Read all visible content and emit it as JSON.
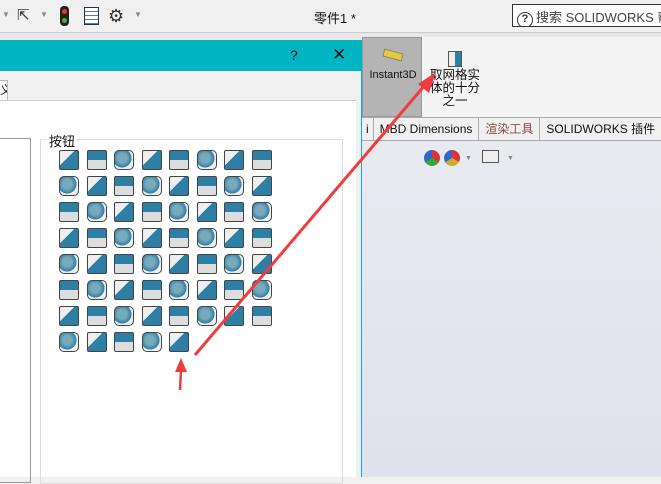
{
  "toolbar": {
    "title": "零件1 *",
    "search_placeholder": "搜索 SOLIDWORKS 帮助",
    "icons": [
      "chevron-down-icon",
      "cursor-icon",
      "traffic-light-icon",
      "properties-list-icon",
      "gear-icon"
    ]
  },
  "ribbon": {
    "instant3d_label": "Instant3D",
    "mesh_button_label": "取网格实体的十分之一"
  },
  "tabs": [
    "i",
    "MBD Dimensions",
    "渲染工具",
    "SOLIDWORKS 插件"
  ],
  "tab_colors": {
    "render": "#8b4a4a"
  },
  "dialog": {
    "help": "?",
    "close": "✕",
    "tab_fragment": "义",
    "group_label": "按钮",
    "icon_count": 61
  },
  "colors": {
    "accent": "#00b5c1",
    "icon_blue": "#2e7fa6",
    "arrow": "#f03c3c"
  }
}
